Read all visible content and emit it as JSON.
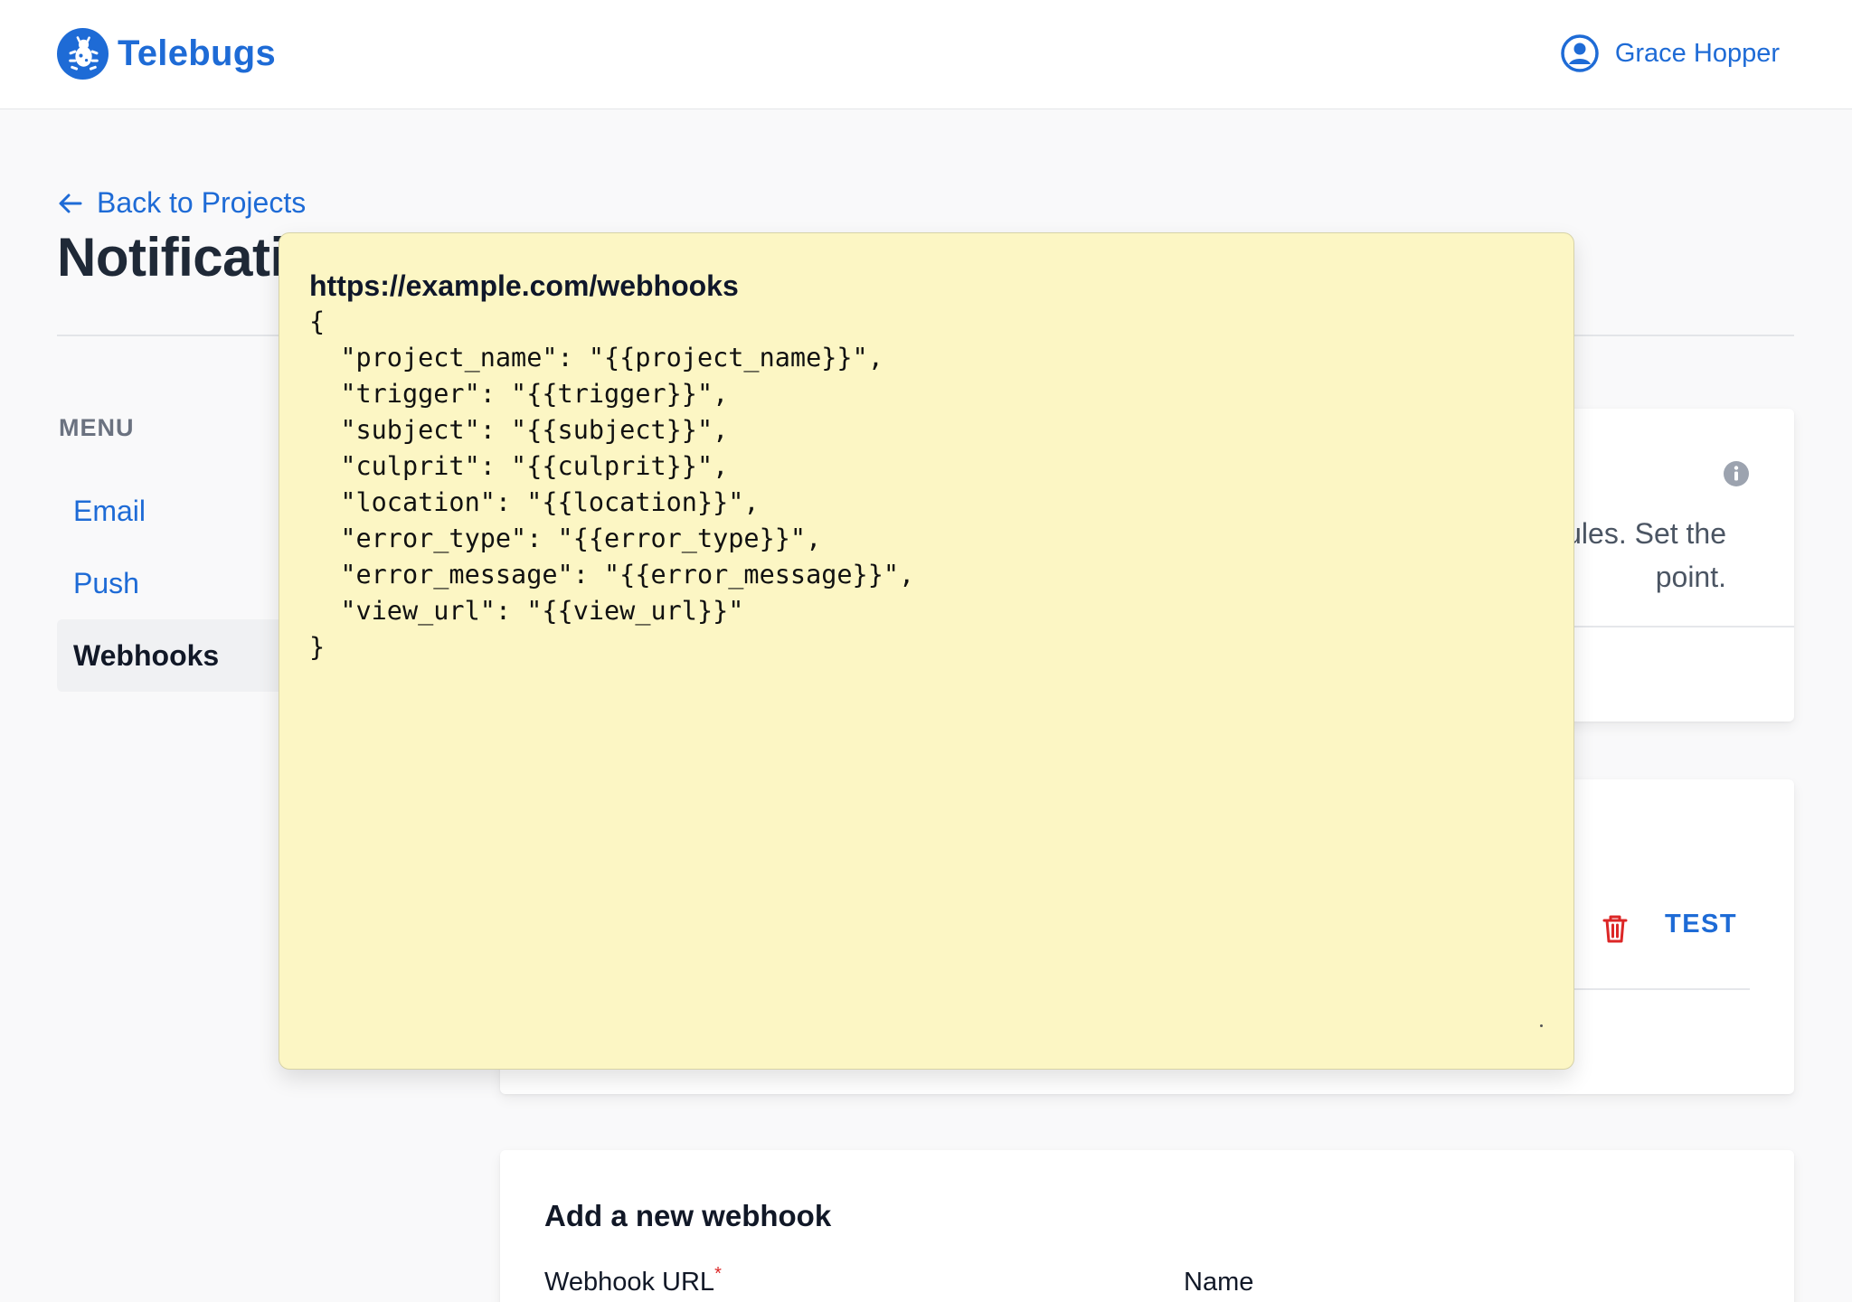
{
  "header": {
    "brand": "Telebugs",
    "user_name": "Grace Hopper",
    "brand_color": "#1e6bd6"
  },
  "page": {
    "back_link": "Back to Projects",
    "title": "Notificati"
  },
  "sidebar": {
    "label": "MENU",
    "items": [
      {
        "label": "Email",
        "active": false
      },
      {
        "label": "Push",
        "active": false
      },
      {
        "label": "Webhooks",
        "active": true
      }
    ]
  },
  "webhooks_card": {
    "description_line1": "ules. Set the",
    "description_line2": "point."
  },
  "webhook_item": {
    "test_label": "TEST"
  },
  "new_webhook": {
    "title": "Add a new webhook",
    "url_label": "Webhook URL",
    "required_mark": "*",
    "name_label": "Name"
  },
  "tooltip": {
    "url": "https://example.com/webhooks",
    "payload": "{\n  \"project_name\": \"{{project_name}}\",\n  \"trigger\": \"{{trigger}}\",\n  \"subject\": \"{{subject}}\",\n  \"culprit\": \"{{culprit}}\",\n  \"location\": \"{{location}}\",\n  \"error_type\": \"{{error_type}}\",\n  \"error_message\": \"{{error_message}}\",\n  \"view_url\": \"{{view_url}}\"\n}",
    "background": "#fcf6c4"
  }
}
